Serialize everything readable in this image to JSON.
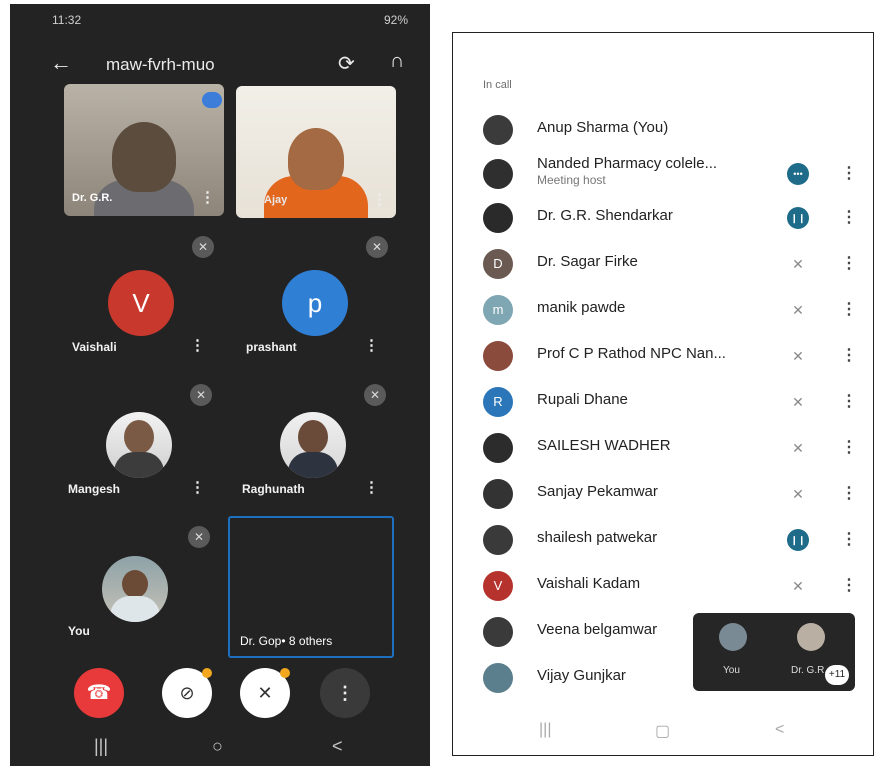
{
  "left_phone": {
    "status": {
      "time": "11:32",
      "system": "92%"
    },
    "header": {
      "back_icon": "arrow-left-icon",
      "meeting_code": "maw-fvrh-muo",
      "rotate_icon": "camera-rotate-icon",
      "audio_icon": "headphones-icon"
    },
    "video_tiles": [
      {
        "label": "Dr. G.R."
      },
      {
        "label": "Ajay"
      }
    ],
    "participants": [
      {
        "name": "Vaishali",
        "initial": "V",
        "color": "#c8382d"
      },
      {
        "name": "prashant",
        "initial": "p",
        "color": "#2f7fd5"
      },
      {
        "name": "Mangesh"
      },
      {
        "name": "Raghunath"
      },
      {
        "name": "You"
      }
    ],
    "others_tile": {
      "label": "Dr. Gop•  8 others"
    },
    "controls": {
      "end": "end-call-icon",
      "camera": "camera-off-icon",
      "mic": "mic-off-icon",
      "more": "more-vert-icon"
    },
    "nav": {
      "recents": "|||",
      "home": "○",
      "back": "<"
    }
  },
  "right_phone": {
    "section_label": "In call",
    "participants": [
      {
        "name": "Anup Sharma (You)",
        "sub": "",
        "status": "none",
        "avatar_color": "#3b3b3b",
        "initial": ""
      },
      {
        "name": "Nanded Pharmacy colele...",
        "sub": "Meeting host",
        "status": "more",
        "avatar_color": "#2f2f2f",
        "initial": ""
      },
      {
        "name": "Dr. G.R. Shendarkar",
        "sub": "",
        "status": "speaking",
        "avatar_color": "#2a2a2a",
        "initial": ""
      },
      {
        "name": "Dr. Sagar Firke",
        "sub": "",
        "status": "muted",
        "avatar_color": "#6b5a52",
        "initial": "D"
      },
      {
        "name": "manik pawde",
        "sub": "",
        "status": "muted",
        "avatar_color": "#7fa6b3",
        "initial": "m"
      },
      {
        "name": "Prof C P Rathod NPC Nan...",
        "sub": "",
        "status": "muted",
        "avatar_color": "#8a4a3c",
        "initial": ""
      },
      {
        "name": "Rupali Dhane",
        "sub": "",
        "status": "muted",
        "avatar_color": "#2b76b8",
        "initial": "R"
      },
      {
        "name": "SAILESH WADHER",
        "sub": "",
        "status": "muted",
        "avatar_color": "#2c2c2c",
        "initial": ""
      },
      {
        "name": "Sanjay Pekamwar",
        "sub": "",
        "status": "muted",
        "avatar_color": "#333333",
        "initial": ""
      },
      {
        "name": "shailesh patwekar",
        "sub": "",
        "status": "speaking",
        "avatar_color": "#3a3a3a",
        "initial": ""
      },
      {
        "name": "Vaishali Kadam",
        "sub": "",
        "status": "muted",
        "avatar_color": "#b5332c",
        "initial": "V"
      },
      {
        "name": "Veena belgamwar",
        "sub": "",
        "status": "none",
        "avatar_color": "#3a3a3a",
        "initial": ""
      },
      {
        "name": "Vijay Gunjkar",
        "sub": "",
        "status": "none",
        "avatar_color": "#5b7f8c",
        "initial": ""
      }
    ],
    "float_panel": {
      "you_label": "You",
      "other_label": "Dr. G.R.",
      "count": "+11"
    },
    "nav": {
      "recents": "|||",
      "home": "▢",
      "back": "<"
    }
  },
  "icons": {
    "mute": "mic-off-icon",
    "menu": "more-vert-icon"
  }
}
